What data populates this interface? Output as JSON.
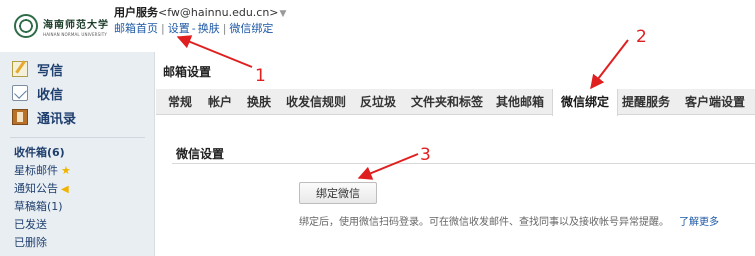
{
  "header": {
    "logo": {
      "cn": "海南师范大学",
      "en": "HAINAN NORMAL UNIVERSITY"
    },
    "account_name": "用户服务",
    "account_email": "<fw@hainnu.edu.cn>",
    "account_caret": "▼",
    "links": {
      "home": "邮箱首页",
      "sep": "|",
      "settings": "设置",
      "dash": "-",
      "skin": "换肤",
      "wechat": "微信绑定"
    }
  },
  "sidebar": {
    "actions": {
      "write": "写信",
      "receive": "收信",
      "contacts": "通讯录"
    },
    "folders": {
      "inbox": "收件箱(6)",
      "starred": "星标邮件",
      "notice": "通知公告",
      "drafts": "草稿箱(1)",
      "sent": "已发送",
      "deleted": "已删除"
    }
  },
  "main": {
    "title": "邮箱设置",
    "tabs": [
      "常规",
      "帐户",
      "换肤",
      "收发信规则",
      "反垃圾",
      "文件夹和标签",
      "其他邮箱",
      "微信绑定",
      "提醒服务",
      "客户端设置"
    ],
    "active_tab_index": 7,
    "section_title": "微信设置",
    "bind_button": "绑定微信",
    "description": "绑定后，使用微信扫码登录。可在微信收发邮件、查找同事以及接收帐号异常提醒。",
    "learn_more": "了解更多"
  },
  "annotations": {
    "n1": "1",
    "n2": "2",
    "n3": "3",
    "color": "#e02020"
  }
}
